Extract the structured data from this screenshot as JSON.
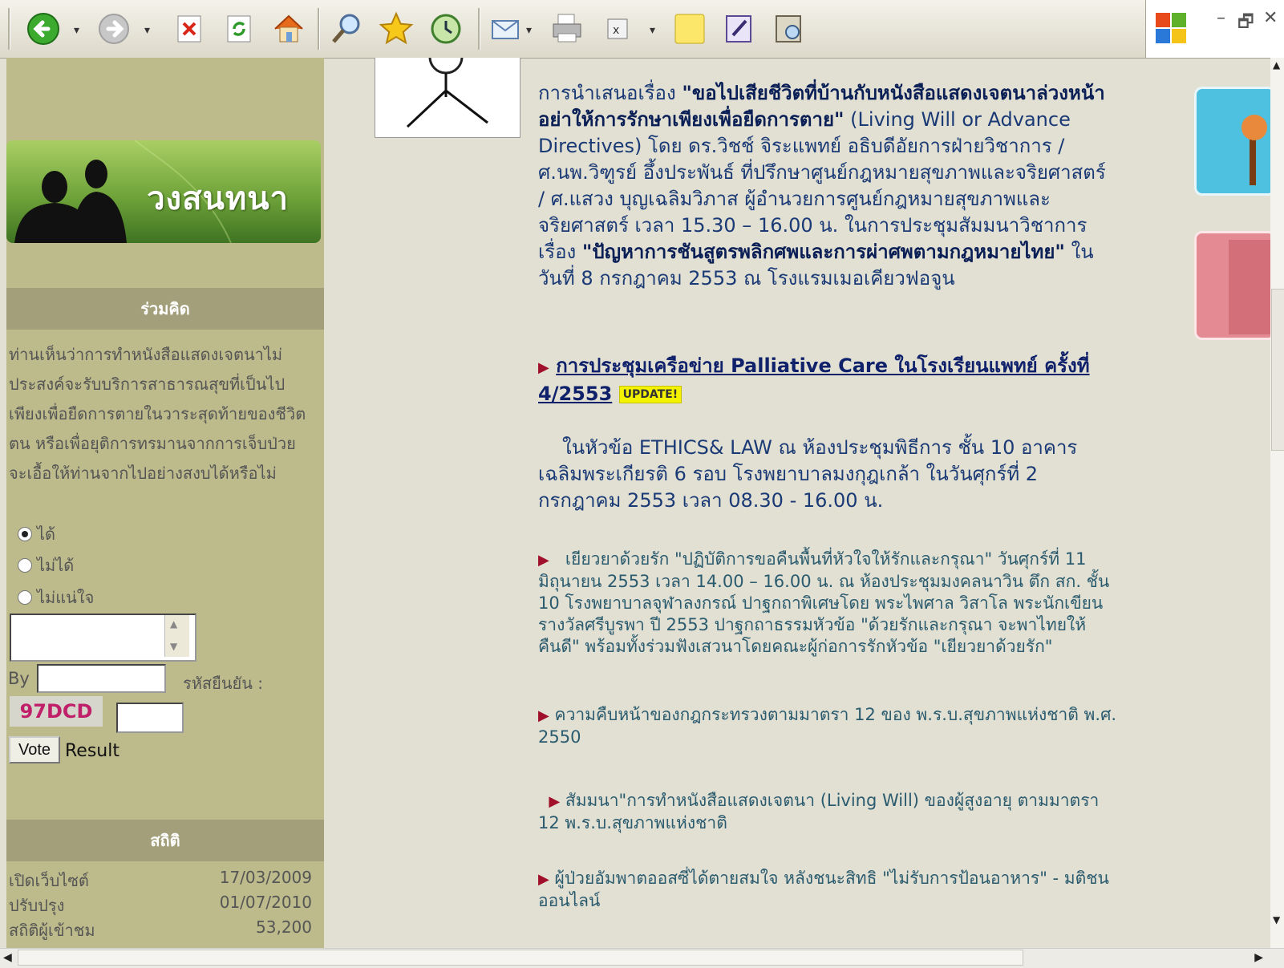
{
  "toolbar": {
    "buttons": [
      "back-icon",
      "forward-icon",
      "stop-icon",
      "refresh-icon",
      "home-icon",
      "search-icon",
      "favorites-icon",
      "history-icon",
      "mail-icon",
      "print-icon",
      "excel-icon",
      "notes-icon",
      "edit-icon",
      "research-icon"
    ],
    "dropdown_glyph": "▾"
  },
  "window_controls": {
    "minimize": "–",
    "restore": "🗗",
    "close": "✕"
  },
  "sidebar": {
    "banner_title": "วงสนทนา",
    "poll_header": "ร่วมคิด",
    "poll_question": "ท่านเห็นว่าการทำหนังสือแสดงเจตนาไม่ประสงค์จะรับบริการสาธารณสุขที่เป็นไปเพียงเพื่อยืดการตายในวาระสุดท้ายของชีวิตตน หรือเพื่อยุติการทรมานจากการเจ็บป่วย จะเอื้อให้ท่านจากไปอย่างสงบได้หรือไม่",
    "options": [
      "ได้",
      "ไม่ได้",
      "ไม่แน่ใจ"
    ],
    "by_label": "By",
    "code_label": "รหัสยืนยัน :",
    "captcha": "97DCD",
    "vote_label": "Vote",
    "result_label": "Result",
    "stats_header": "สถิติ",
    "stats": [
      {
        "label": "เปิดเว็บไซต์",
        "value": "17/03/2009"
      },
      {
        "label": "ปรับปรุง",
        "value": "01/07/2010"
      },
      {
        "label": "สถิติผู้เข้าชม",
        "value": "53,200"
      }
    ]
  },
  "main": {
    "p1_prefix": "การนำเสนอเรื่อง",
    "p1_bold": "\"ขอไปเสียชีวิตที่บ้านกับหนังสือแสดงเจตนาล่วงหน้า อย่าให้การรักษาเพียงเพื่อยืดการตาย\"",
    "p1_rest": "(Living Will or Advance Directives) โดย ดร.วิชช์ จิระแพทย์ อธิบดีอัยการฝ่ายวิชาการ / ศ.นพ.วิฑูรย์ อึ้งประพันธ์ ที่ปรึกษาศูนย์กฎหมายสุขภาพและจริยศาสตร์ / ศ.แสวง บุญเฉลิมวิภาส ผู้อำนวยการศูนย์กฎหมายสุขภาพและจริยศาสตร์ เวลา 15.30 – 16.00 น. ในการประชุมสัมมนาวิชาการ เรื่อง",
    "p1_bold2": "\"ปัญหาการชันสูตรพลิกศพและการผ่าศพตามกฎหมายไทย\"",
    "p1_tail": "ในวันที่ 8 กรกฎาคม 2553 ณ โรงแรมเมอเคียวฟอจูน",
    "news1_link": "การประชุมเครือข่าย Palliative Care ในโรงเรียนแพทย์ ครั้งที่ 4/2553",
    "update_badge": "UPDATE!",
    "news1_body": "ในหัวข้อ ETHICS& LAW ณ ห้องประชุมพิธีการ ชั้น 10 อาคารเฉลิมพระเกียรติ 6 รอบ โรงพยาบาลมงกุฎเกล้า ในวันศุกร์ที่ 2 กรกฎาคม 2553 เวลา 08.30 - 16.00 น.",
    "news2": "เยียวยาด้วยรัก \"ปฏิบัติการขอคืนพื้นที่หัวใจให้รักและกรุณา\" วันศุกร์ที่ 11 มิถุนายน 2553 เวลา 14.00 – 16.00 น. ณ ห้องประชุมมงคลนาวิน ตึก สก. ชั้น 10 โรงพยาบาลจุฬาลงกรณ์ ปาฐกถาพิเศษโดย พระไพศาล วิสาโล พระนักเขียนรางวัลศรีบูรพา ปี 2553 ปาฐกถาธรรมหัวข้อ \"ด้วยรักและกรุณา จะพาไทยให้คืนดี\" พร้อมทั้งร่วมฟังเสวนาโดยคณะผู้ก่อการรักหัวข้อ \"เยียวยาด้วยรัก\"",
    "news3": "ความคืบหน้าของกฎกระทรวงตามมาตรา 12 ของ พ.ร.บ.สุขภาพแห่งชาติ พ.ศ. 2550",
    "news4": "สัมมนา\"การทำหนังสือแสดงเจตนา (Living Will) ของผู้สูงอายุ ตามมาตรา 12 พ.ร.บ.สุขภาพแห่งชาติ",
    "news5": "ผู้ป่วยอัมพาตออสซี่ได้ตายสมใจ หลังชนะสิทธิ \"ไม่รับการป้อนอาหาร\" - มติชนออนไลน์"
  },
  "colors": {
    "sidebar_bg": "#bdbb8b",
    "header_bg": "#a29f7a",
    "page_bg": "#e2dfd3",
    "link": "#10216b",
    "bullet": "#a0102a"
  }
}
